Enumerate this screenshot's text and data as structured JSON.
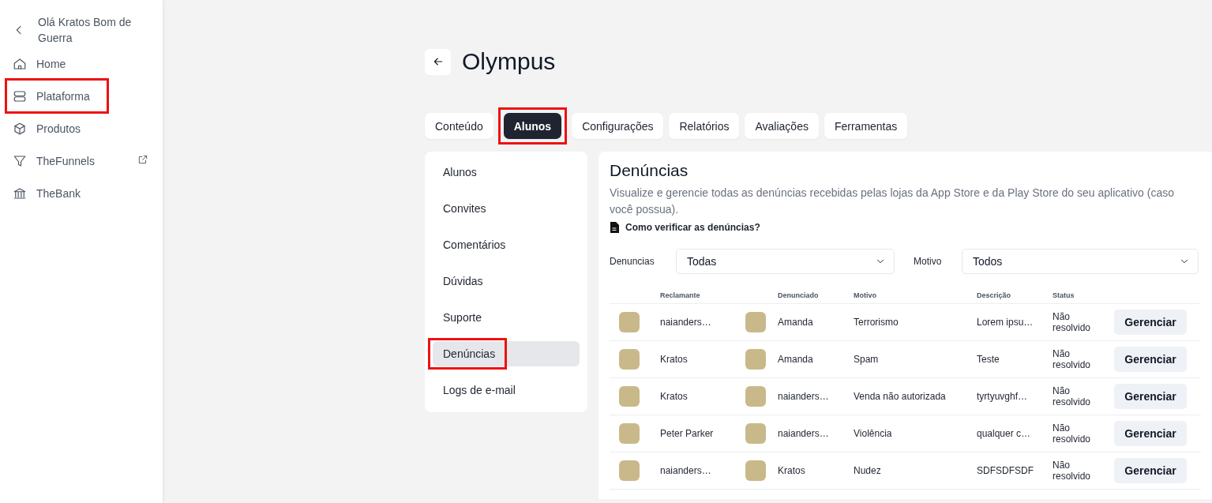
{
  "sidebar": {
    "greeting": "Olá Kratos Bom de Guerra",
    "items": [
      {
        "label": "Home",
        "external": false,
        "highlighted": false
      },
      {
        "label": "Plataforma",
        "external": false,
        "highlighted": true
      },
      {
        "label": "Produtos",
        "external": false,
        "highlighted": false
      },
      {
        "label": "TheFunnels",
        "external": true,
        "highlighted": false
      },
      {
        "label": "TheBank",
        "external": false,
        "highlighted": false
      }
    ]
  },
  "page": {
    "title": "Olympus"
  },
  "tabs": [
    {
      "label": "Conteúdo",
      "selected": false,
      "highlighted": false
    },
    {
      "label": "Alunos",
      "selected": true,
      "highlighted": true
    },
    {
      "label": "Configurações",
      "selected": false,
      "highlighted": false
    },
    {
      "label": "Relatórios",
      "selected": false,
      "highlighted": false
    },
    {
      "label": "Avaliações",
      "selected": false,
      "highlighted": false
    },
    {
      "label": "Ferramentas",
      "selected": false,
      "highlighted": false
    }
  ],
  "subnav": [
    {
      "label": "Alunos",
      "selected": false,
      "highlighted": false
    },
    {
      "label": "Convites",
      "selected": false,
      "highlighted": false
    },
    {
      "label": "Comentários",
      "selected": false,
      "highlighted": false
    },
    {
      "label": "Dúvidas",
      "selected": false,
      "highlighted": false
    },
    {
      "label": "Suporte",
      "selected": false,
      "highlighted": false
    },
    {
      "label": "Denúncias",
      "selected": true,
      "highlighted": true
    },
    {
      "label": "Logs de e-mail",
      "selected": false,
      "highlighted": false
    }
  ],
  "panel": {
    "title": "Denúncias",
    "description": "Visualize e gerencie todas as denúncias recebidas pelas lojas da App Store e da Play Store do seu aplicativo (caso você possua).",
    "help_link": "Como verificar as denúncias?",
    "filters": [
      {
        "label": "Denuncias",
        "value": "Todas"
      },
      {
        "label": "Motivo",
        "value": "Todos"
      }
    ],
    "table": {
      "columns": [
        "Reclamante",
        "Denunciado",
        "Motivo",
        "Descrição",
        "Status"
      ],
      "rows": [
        {
          "reclamante": "naianders…",
          "denunciado": "Amanda",
          "motivo": "Terrorismo",
          "descricao": "Lorem ipsu…",
          "status": "Não resolvido",
          "action": "Gerenciar"
        },
        {
          "reclamante": "Kratos",
          "denunciado": "Amanda",
          "motivo": "Spam",
          "descricao": "Teste",
          "status": "Não resolvido",
          "action": "Gerenciar"
        },
        {
          "reclamante": "Kratos",
          "denunciado": "naianders…",
          "motivo": "Venda não autorizada",
          "descricao": "tyrtyuvghf…",
          "status": "Não resolvido",
          "action": "Gerenciar"
        },
        {
          "reclamante": "Peter Parker",
          "denunciado": "naianders…",
          "motivo": "Violência",
          "descricao": "qualquer c…",
          "status": "Não resolvido",
          "action": "Gerenciar"
        },
        {
          "reclamante": "naianders…",
          "denunciado": "Kratos",
          "motivo": "Nudez",
          "descricao": "SDFSDFSDF",
          "status": "Não resolvido",
          "action": "Gerenciar"
        }
      ]
    }
  }
}
